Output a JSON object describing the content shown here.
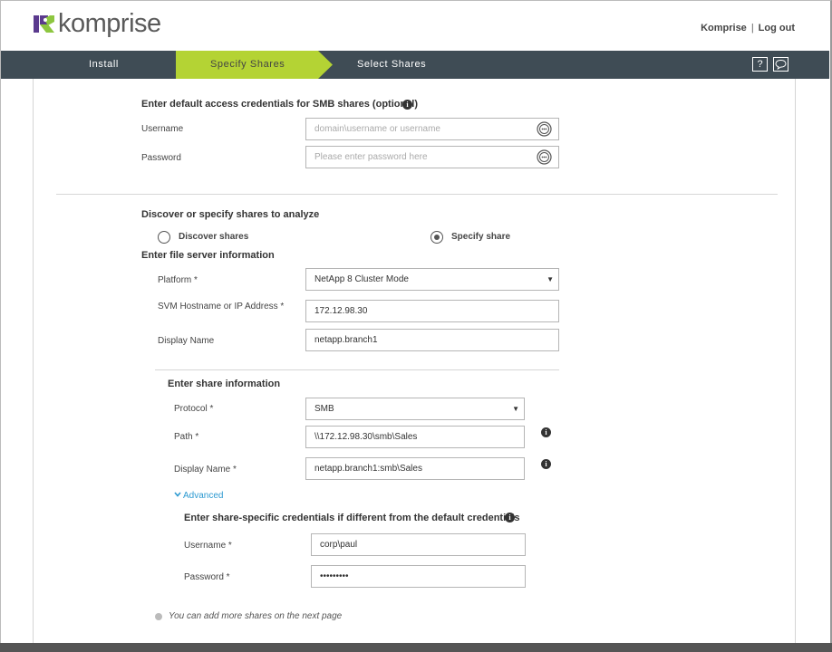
{
  "header": {
    "brand": "komprise",
    "user_link": "Komprise",
    "separator": "|",
    "logout_link": "Log out",
    "brand_colors": {
      "purple": "#5b3a8e",
      "green": "#8dc63f"
    }
  },
  "nav": {
    "steps": [
      {
        "label": "Install",
        "state": "done"
      },
      {
        "label": "Specify Shares",
        "state": "active"
      },
      {
        "label": "Select Shares",
        "state": "pending"
      }
    ],
    "help_icon": "?",
    "active_color": "#b4d334",
    "bar_color": "#3f4c55"
  },
  "default_creds": {
    "title": "Enter default access credentials for SMB shares (optional)",
    "username_label": "Username",
    "username_placeholder": "domain\\username or username",
    "password_label": "Password",
    "password_placeholder": "Please enter password here"
  },
  "discover": {
    "title": "Discover or specify shares to analyze",
    "option_discover": "Discover shares",
    "option_specify": "Specify share",
    "selected": "Specify share"
  },
  "server": {
    "title": "Enter file server information",
    "platform_label": "Platform *",
    "platform_value": "NetApp 8 Cluster Mode",
    "hostname_label": "SVM Hostname or IP Address *",
    "hostname_value": "172.12.98.30",
    "display_label": "Display Name",
    "display_value": "netapp.branch1"
  },
  "share": {
    "title": "Enter share information",
    "protocol_label": "Protocol *",
    "protocol_value": "SMB",
    "path_label": "Path *",
    "path_value": "\\\\172.12.98.30\\smb\\Sales",
    "display_label": "Display Name *",
    "display_value": "netapp.branch1:smb\\Sales",
    "advanced_label": "Advanced"
  },
  "share_creds": {
    "title": "Enter share-specific credentials if different from the default credentials",
    "username_label": "Username *",
    "username_value": "corp\\paul",
    "password_label": "Password *",
    "password_value": "•••••••••"
  },
  "note": "You can add more shares on the next page"
}
